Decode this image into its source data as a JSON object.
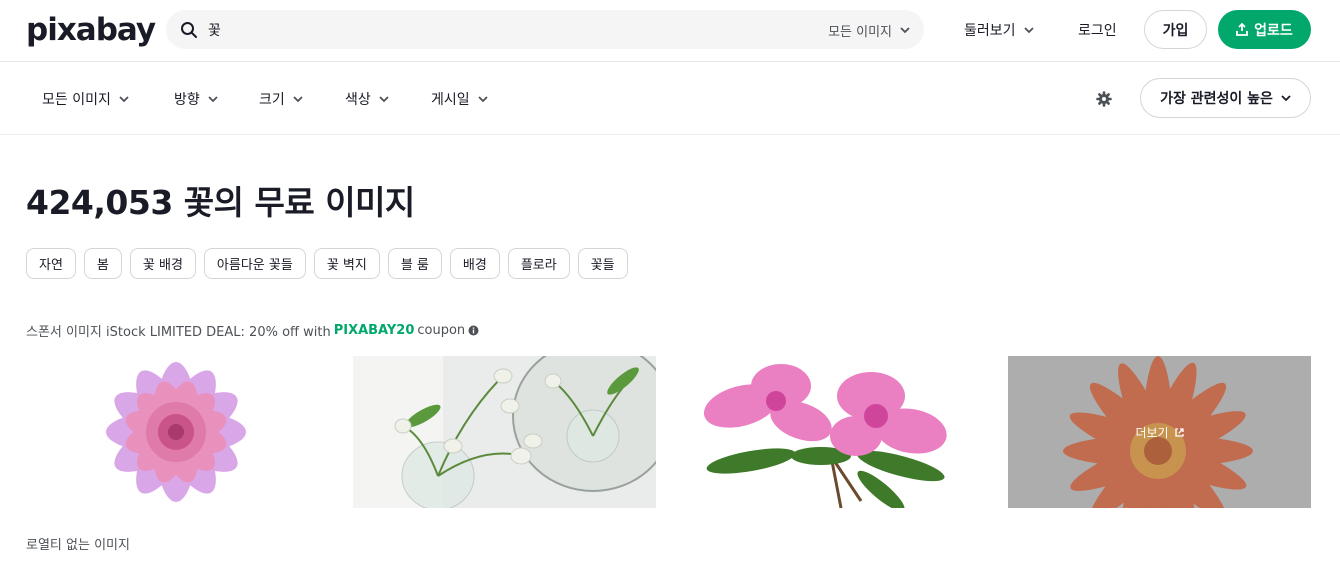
{
  "header": {
    "logo": "pixabay",
    "search": {
      "value": "꽃",
      "scope": "모든 이미지"
    },
    "explore": "둘러보기",
    "login": "로그인",
    "join": "가입",
    "upload": "업로드"
  },
  "filters": {
    "items": [
      "모든 이미지",
      "방향",
      "크기",
      "색상",
      "게시일"
    ],
    "sort": "가장 관련성이 높은"
  },
  "main": {
    "title": "424,053 꽃의 무료 이미지",
    "tags": [
      "자연",
      "봄",
      "꽃 배경",
      "아름다운 꽃들",
      "꽃 벽지",
      "블 룸",
      "배경",
      "플로라",
      "꽃들"
    ],
    "sponsor": {
      "prefix": "스폰서 이미지 iStock LIMITED DEAL: 20% off with",
      "code": "PIXABAY20",
      "suffix": "coupon"
    },
    "more_label": "더보기",
    "royalty_heading": "로열티 없는 이미지"
  },
  "colors": {
    "brand_green": "#02a86b"
  },
  "icons": [
    "search-icon",
    "chevron-down-icon",
    "upload-icon",
    "gear-icon",
    "info-icon",
    "external-link-icon"
  ]
}
